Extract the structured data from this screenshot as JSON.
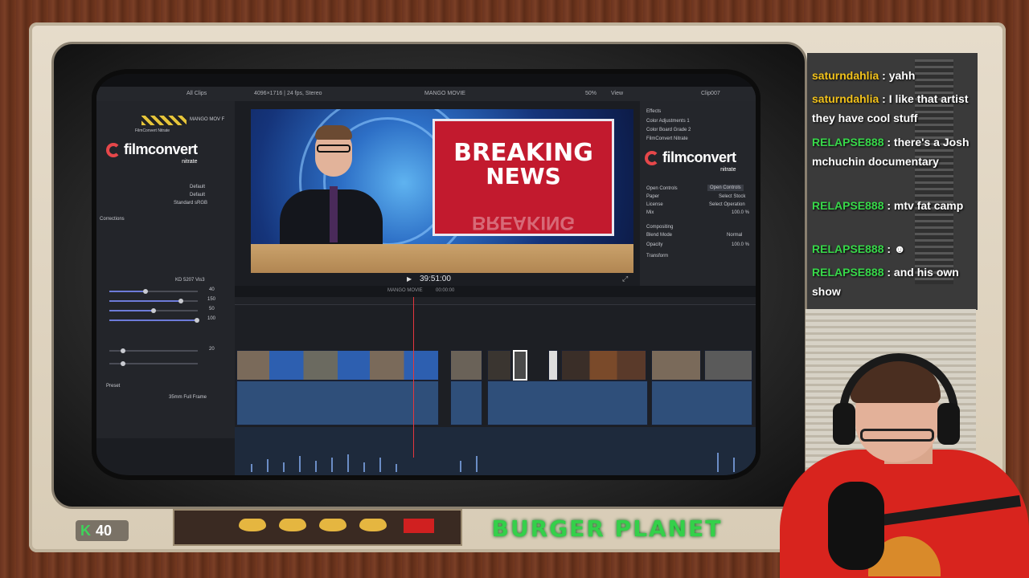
{
  "editor": {
    "menu_fragment": "",
    "toolbar": {
      "all_clips": "All Clips",
      "format": "4096×1716 | 24 fps, Stereo",
      "project": "MANGO MOVIE",
      "zoom": "50%",
      "view": "View",
      "clip": "Clip007"
    },
    "left_inspector": {
      "effect_name": "MANGO MOV F",
      "effect_sub": "FilmConvert Nitrate",
      "brand": "filmconvert",
      "brand_sub": "nitrate",
      "rows": [
        {
          "label": "Default",
          "value": "Default"
        },
        {
          "label": "Default",
          "value": "Default"
        },
        {
          "label": "Standard sRGB",
          "value": "Standard sRGB"
        }
      ],
      "section_corrections": "Corrections",
      "preset_label": "Preset",
      "preset_value": "35mm Full Frame",
      "stock": "KD 5207 Vis3",
      "slider_values": [
        "40",
        "150",
        "50",
        "100",
        "20"
      ]
    },
    "viewer": {
      "headline_1": "BREAKING",
      "headline_2": "NEWS",
      "reflection": "BREAKING",
      "timecode": "39:51:00"
    },
    "right_inspector": {
      "effects": "Effects",
      "items": [
        "Color Adjustments 1",
        "Color Board Grade 2",
        "FilmConvert Nitrate"
      ],
      "brand": "filmconvert",
      "brand_sub": "nitrate",
      "open_controls": "Open Controls",
      "open_controls_btn": "Open Controls",
      "paper": "Paper",
      "paper_value": "Select Stock",
      "license": "License",
      "license_value": "Select Operation",
      "mix": "Mix",
      "mix_value": "100.0 %",
      "compositing": "Compositing",
      "blend_mode": "Blend Mode",
      "blend_value": "Normal",
      "opacity": "Opacity",
      "opacity_value": "100.0 %",
      "transform": "Transform"
    },
    "timeline": {
      "project": "MANGO MOVIE",
      "duration": "00:00:00"
    }
  },
  "chat": {
    "messages": [
      {
        "user": "saturndahlia",
        "text": " : yahh",
        "color": "yellow"
      },
      {
        "user": "saturndahlia",
        "text": " : I like that artist they have cool stuff",
        "color": "yellow"
      },
      {
        "user": "RELAPSE888",
        "text": " : there's a Josh mchuchin documentary",
        "color": "green"
      },
      {
        "user": "RELAPSE888",
        "text": " : mtv fat camp",
        "color": "green"
      },
      {
        "user": "RELAPSE888",
        "text": " : ☻",
        "color": "green"
      },
      {
        "user": "RELAPSE888",
        "text": " : and his own show",
        "color": "green"
      }
    ]
  },
  "overlay": {
    "counter_icon": "K",
    "counter_value": "40",
    "brand_text": "BURGER PLANET",
    "knob_labels": [
      "",
      "",
      "",
      "",
      ""
    ]
  },
  "colors": {
    "chat_user_yellow": "#f2c21b",
    "chat_user_green": "#38d84a",
    "brand_green": "#34d04a",
    "playhead": "#e4373d"
  }
}
